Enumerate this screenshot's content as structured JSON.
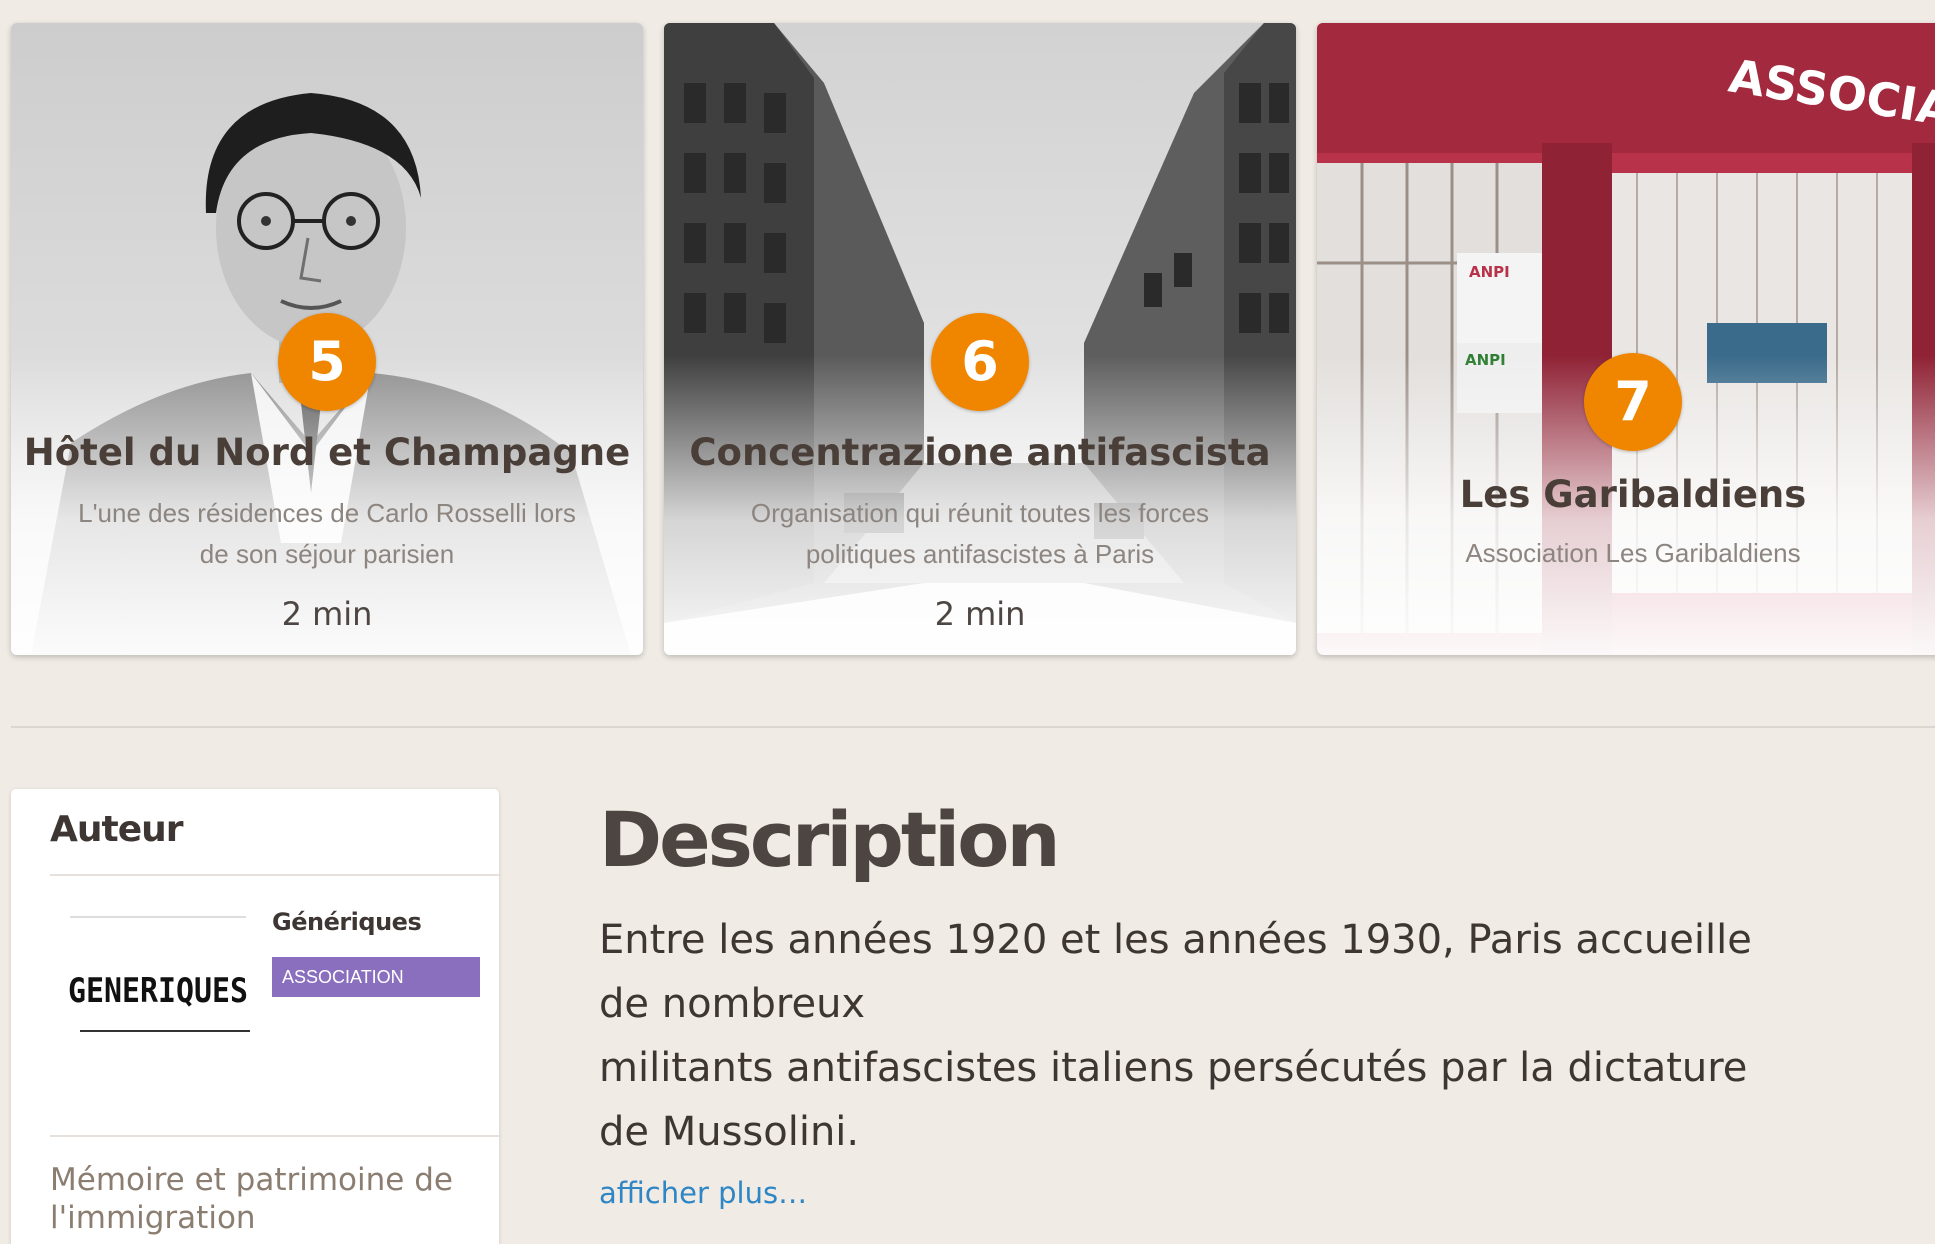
{
  "stops": [
    {
      "number": "5",
      "title": "Hôtel du Nord et Champagne",
      "description": "L'une des résidences de Carlo Rosselli lors de son séjour parisien",
      "duration": "2 min"
    },
    {
      "number": "6",
      "title": "Concentrazione antifascista",
      "description": "Organisation qui réunit toutes les forces politiques antifascistes à Paris",
      "duration": "2 min"
    },
    {
      "number": "7",
      "title": "Les Garibaldiens",
      "description": "Association Les Garibaldiens",
      "duration": "",
      "photo_signs": [
        "ASSOCIATI",
        "ANPI",
        "ANPI"
      ]
    }
  ],
  "author": {
    "heading": "Auteur",
    "name": "Génériques",
    "tag": "ASSOCIATION",
    "logo_text": "GENERIQUES",
    "bio": "Mémoire et patrimoine de l'immigration"
  },
  "description": {
    "heading": "Description",
    "line_1": "Entre les années 1920 et les années 1930, Paris accueille de nombreux",
    "line_2": "militants antifascistes italiens persécutés par la dictature de Mussolini.",
    "more_link": "afficher plus…"
  },
  "colors": {
    "background": "#f0ebe5",
    "badge": "#f08600",
    "tag": "#8a6fbf",
    "link": "#2f86c4"
  }
}
